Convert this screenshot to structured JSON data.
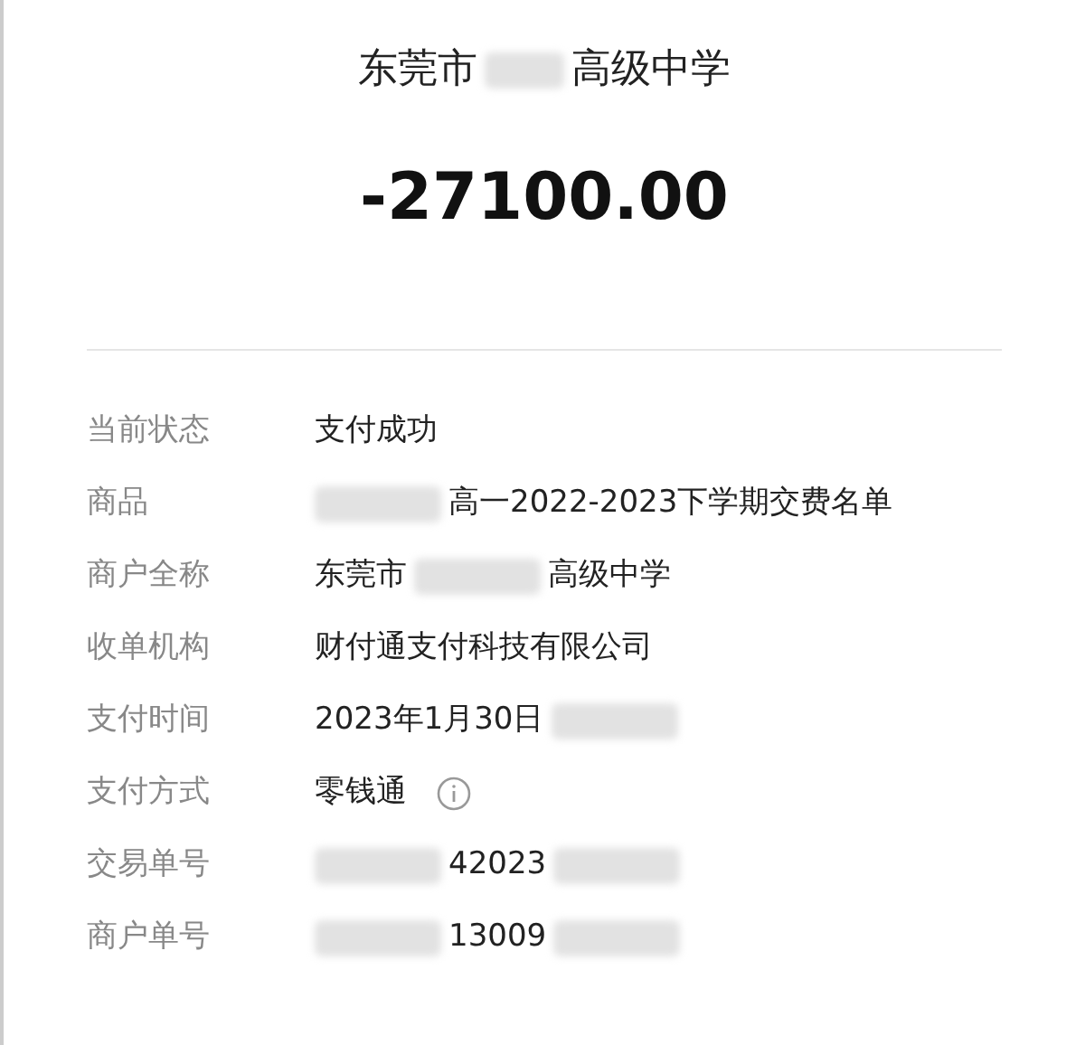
{
  "header": {
    "payee": [
      {
        "kind": "text",
        "text": "东莞市"
      },
      {
        "kind": "redacted"
      },
      {
        "kind": "text",
        "text": "高级中学"
      }
    ],
    "amount": "-27100.00"
  },
  "details": [
    {
      "label": "当前状态",
      "value": [
        {
          "kind": "text",
          "text": "支付成功"
        }
      ]
    },
    {
      "label": "商品",
      "value": [
        {
          "kind": "redacted"
        },
        {
          "kind": "text",
          "text": "高一2022-2023下学期交费名单"
        }
      ]
    },
    {
      "label": "商户全称",
      "value": [
        {
          "kind": "text",
          "text": "东莞市"
        },
        {
          "kind": "redacted"
        },
        {
          "kind": "text",
          "text": "高级中学"
        }
      ]
    },
    {
      "label": "收单机构",
      "value": [
        {
          "kind": "text",
          "text": "财付通支付科技有限公司"
        }
      ]
    },
    {
      "label": "支付时间",
      "value": [
        {
          "kind": "text",
          "text": "2023年1月30日"
        },
        {
          "kind": "redacted"
        }
      ]
    },
    {
      "label": "支付方式",
      "value": [
        {
          "kind": "text",
          "text": "零钱通"
        },
        {
          "kind": "info"
        }
      ]
    },
    {
      "label": "交易单号",
      "value": [
        {
          "kind": "redacted"
        },
        {
          "kind": "text",
          "text": "42023"
        },
        {
          "kind": "redacted"
        }
      ]
    },
    {
      "label": "商户单号",
      "value": [
        {
          "kind": "redacted"
        },
        {
          "kind": "text",
          "text": "13009"
        },
        {
          "kind": "redacted"
        }
      ]
    }
  ]
}
